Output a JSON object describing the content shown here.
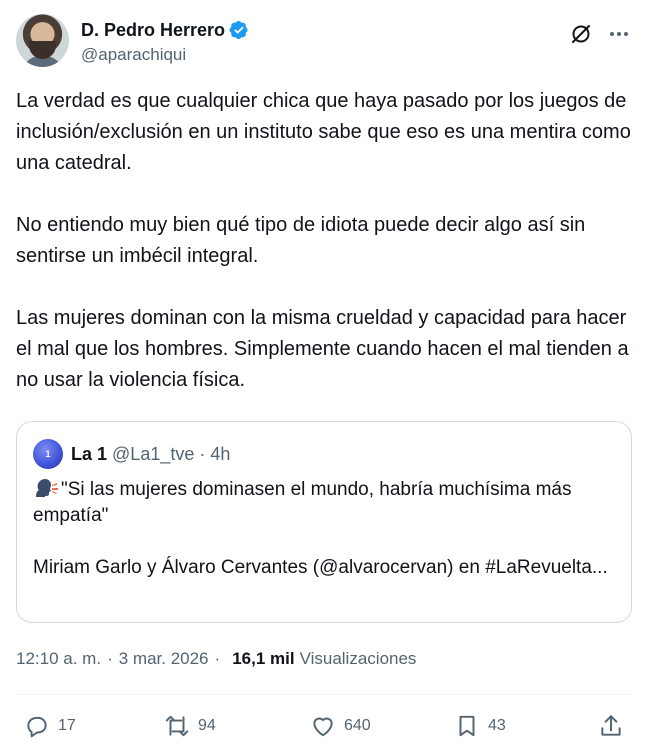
{
  "author": {
    "display_name": "D. Pedro Herrero",
    "handle": "@aparachiqui",
    "verified": true
  },
  "header_icons": [
    "grok-icon",
    "more-icon"
  ],
  "tweet": {
    "paragraphs": [
      "La verdad es que cualquier chica que haya pasado por los juegos de inclusión/exclusión en un instituto sabe que eso es una mentira como una catedral.",
      "No entiendo muy bien qué tipo de idiota puede decir algo así sin sentirse un imbécil integral.",
      "Las mujeres dominan con la misma crueldad y capacidad para hacer el mal que los hombres. Simplemente cuando hacen el mal tienden a no usar la violencia física."
    ]
  },
  "quote": {
    "name": "La 1",
    "handle": "@La1_tve",
    "separator": "·",
    "time": "4h",
    "emoji": "speaking-head-emoji",
    "paragraphs": [
      "\"Si las mujeres dominasen el mundo, habría muchísima más empatía\"",
      "Miriam Garlo y Álvaro Cervantes (@alvarocervan) en #LaRevuelta..."
    ]
  },
  "meta": {
    "time": "12:10 a. m.",
    "separator": "·",
    "date": "3 mar. 2026",
    "views_count": "16,1 mil",
    "views_label": "Visualizaciones"
  },
  "actions": {
    "replies": "17",
    "reposts": "94",
    "likes": "640",
    "bookmarks": "43"
  },
  "colors": {
    "text": "#0f1419",
    "secondary": "#536471",
    "verified": "#1d9bf0",
    "border": "#cfd9de"
  }
}
